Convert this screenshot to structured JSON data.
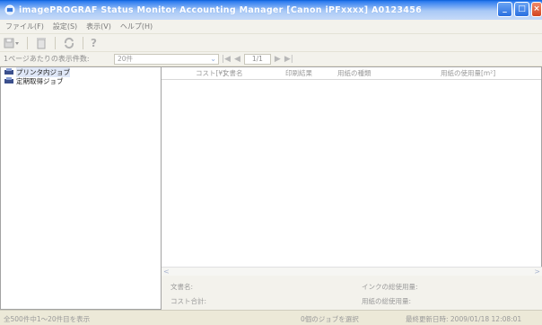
{
  "window": {
    "title": "imagePROGRAF Status Monitor Accounting Manager [Canon iPFxxxx]  A0123456"
  },
  "menu": {
    "items": [
      "ファイル(F)",
      "設定(S)",
      "表示(V)",
      "ヘルプ(H)"
    ]
  },
  "toolbar": {
    "icons": [
      "save-icon",
      "delete-icon",
      "refresh-icon",
      "help-icon"
    ]
  },
  "paging": {
    "per_page_label": "1ページあたりの表示件数:",
    "per_page_value": "20件",
    "page_indicator": "1/1"
  },
  "tree": {
    "items": [
      {
        "label": "プリンタ内ジョブ",
        "selected": true
      },
      {
        "label": "定期取得ジョブ",
        "selected": false
      }
    ]
  },
  "list": {
    "columns": [
      "コスト[¥]",
      "文書名",
      "印刷結果",
      "用紙の種類",
      "用紙の使用量[m²]"
    ]
  },
  "detail": {
    "doc_name_label": "文書名:",
    "cost_total_label": "コスト合計:",
    "ink_total_label": "インクの総使用量:",
    "paper_total_label": "用紙の総使用量:"
  },
  "status": {
    "range": "全500件中1～20件目を表示",
    "selection": "0個のジョブを選択",
    "last_update": "最終更新日時: 2009/01/18 12:08:01"
  }
}
